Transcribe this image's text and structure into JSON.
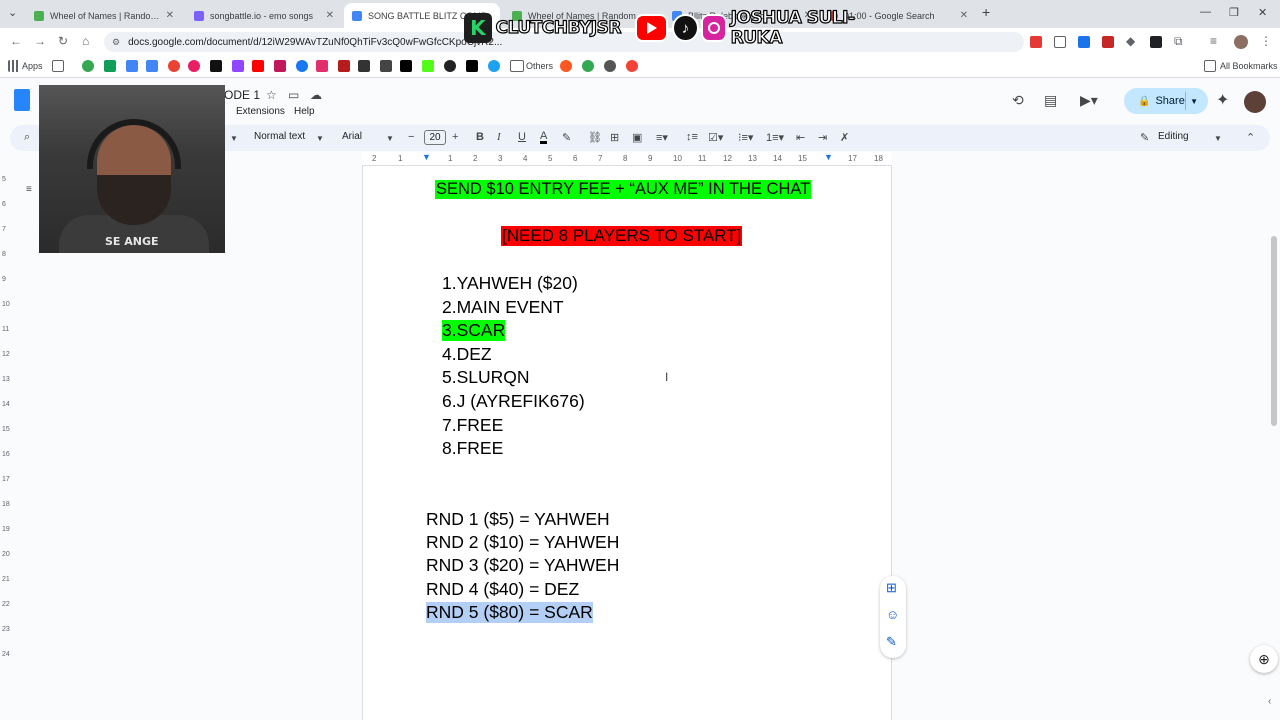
{
  "browser": {
    "tabs": [
      {
        "label": "Wheel of Names | Random nam",
        "color": "#4caf50"
      },
      {
        "label": "songbattle.io - emo songs",
        "color": "#7b61ff"
      },
      {
        "label": "SONG BATTLE BLITZ COMP",
        "color": "#4285f4"
      },
      {
        "label": "Wheel of Names | Random nam",
        "color": "#4caf50"
      },
      {
        "label": "Bllitz Rulebook doc",
        "color": "#4285f4"
      },
      {
        "label": "01:00 - Google Search",
        "color": "#ea4335"
      }
    ],
    "new_tab": "+",
    "url": "docs.google.com/document/d/12iW29WAvTZuNf0QhTiFv3cQ0wFwGfcCKpoCjvR2...",
    "bookmarks": {
      "apps_label": "Apps",
      "others_label": "Others",
      "all_label": "All Bookmarks"
    }
  },
  "overlay": {
    "brand_left": "CLUTCHBYJSR",
    "brand_right": "JOSHUA SULI-RUKA",
    "k_letter": "K",
    "webcam_shirt_text": "SE  ANGE"
  },
  "docs": {
    "title_fragment": "ODE 1",
    "menus": [
      "Extensions",
      "Help"
    ],
    "share_label": "Share",
    "toolbar": {
      "style": "Normal text",
      "font": "Arial",
      "font_size": "20",
      "mode": "Editing"
    },
    "ruler_numbers": [
      "2",
      "1",
      "1",
      "2",
      "3",
      "4",
      "5",
      "6",
      "7",
      "8",
      "9",
      "10",
      "11",
      "12",
      "13",
      "14",
      "15",
      "16",
      "17",
      "18"
    ]
  },
  "document": {
    "entry_fee": "SEND $10 ENTRY FEE + “AUX ME” IN THE CHAT",
    "need_players": "[NEED 8 PLAYERS TO START]",
    "players": [
      {
        "num": "1.",
        "name": "YAHWEH ($20)",
        "highlight": false
      },
      {
        "num": "2.",
        "name": "MAIN EVENT",
        "highlight": false
      },
      {
        "num": "3.",
        "name": "SCAR",
        "highlight": true
      },
      {
        "num": "4.",
        "name": "DEZ",
        "highlight": false
      },
      {
        "num": "5.",
        "name": "SLURQN",
        "highlight": false
      },
      {
        "num": "6.",
        "name": "J (AYREFIK676)",
        "highlight": false
      },
      {
        "num": "7.",
        "name": "FREE",
        "highlight": false
      },
      {
        "num": "8.",
        "name": "FREE",
        "highlight": false
      }
    ],
    "rounds": [
      "RND 1 ($5) = YAHWEH",
      "RND 2 ($10) = YAHWEH",
      "RND 3 ($20) = YAHWEH",
      "RND 4 ($40) = DEZ",
      "RND 5 ($80) = SCAR"
    ]
  },
  "colors": {
    "highlight_green": "#00ff00",
    "highlight_red": "#ff0000",
    "selection": "#b4cff5",
    "share_bg": "#c2e7ff"
  }
}
